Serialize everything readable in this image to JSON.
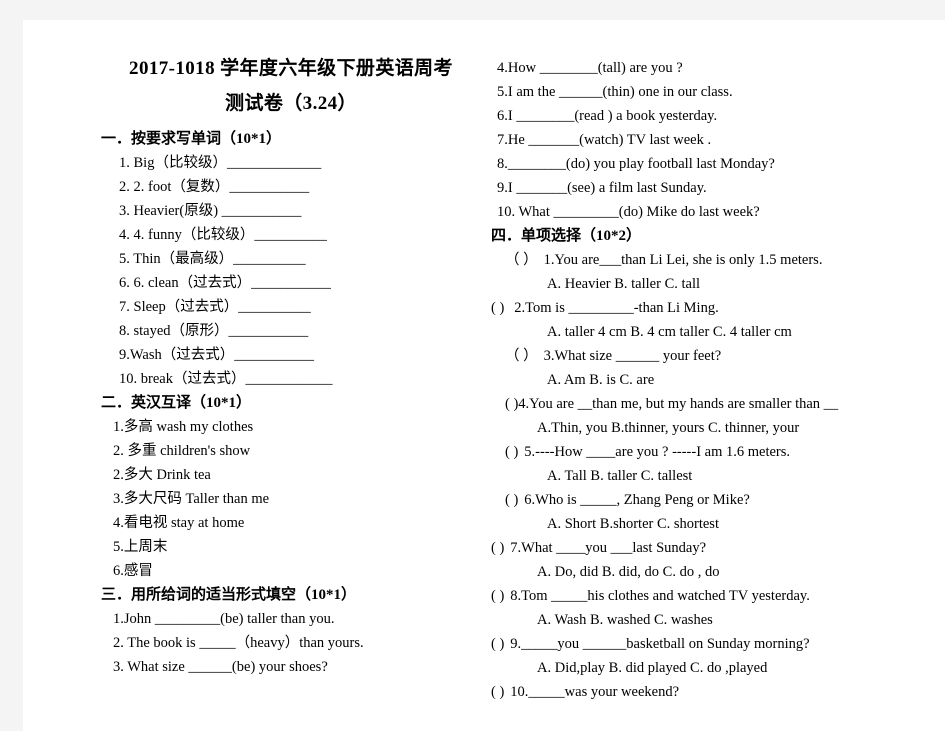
{
  "page": {
    "background_color": "#ffffff",
    "margin_color": "#f4f4f4",
    "text_color": "#000000"
  },
  "title": {
    "line1": "2017-1018 学年度六年级下册英语周考",
    "line2": "测试卷（3.24）"
  },
  "sections": [
    {
      "id": "section-one",
      "heading": "一．按要求写单词（10*1）",
      "items": [
        "1. Big（比较级）_____________",
        "2. 2. foot（复数）___________",
        "3. Heavier(原级) ___________",
        "4. 4. funny（比较级）__________",
        "5. Thin（最高级）__________",
        "6. 6. clean（过去式）___________",
        "7. Sleep（过去式）__________",
        "8. stayed（原形）___________",
        "9.Wash（过去式）___________",
        "10. break（过去式）____________"
      ]
    },
    {
      "id": "section-two",
      "heading": "二．英汉互译（10*1）",
      "items": [
        "1.多高 wash my clothes",
        "2. 多重 children's show",
        "2.多大 Drink tea",
        "3.多大尺码 Taller than me",
        "4.看电视 stay at home",
        "5.上周末",
        "6.感冒"
      ]
    },
    {
      "id": "section-three",
      "heading": "三．用所给词的适当形式填空（10*1）",
      "items": [
        "1.John _________(be) taller than you.",
        "2. The book   is _____（heavy）than yours.",
        "3. What size ______(be) your shoes?",
        "4.How ________(tall) are you ?",
        "5.I am the ______(thin) one in our class.",
        "6.I ________(read ) a book yesterday.",
        "7.He _______(watch) TV last week .",
        "8.________(do) you play football last Monday?",
        "9.I _______(see) a film last Sunday.",
        "10.    What _________(do) Mike do last week?"
      ]
    },
    {
      "id": "section-four",
      "heading": "四．单项选择（10*2）",
      "questions": [
        {
          "bracket": "（ ）",
          "stem": "1.You are___than Li Lei, she is only 1.5 meters.",
          "options": "A. Heavier            B. taller                    C. tall"
        },
        {
          "bracket": "(     )",
          "stem": "2.Tom is _________-than Li Ming.",
          "options": "A.    taller 4 cm      B. 4 cm taller      C. 4 taller cm"
        },
        {
          "bracket": "（ ）",
          "stem": "3.What size ______ your feet?",
          "options": "A. Am                  B. is                  C. are"
        },
        {
          "bracket": "(      )",
          "stem": "4.You are __than me, but my hands are smaller than __",
          "options": "A.Thin, you         B.thinner, yours     C. thinner, your"
        },
        {
          "bracket": "(     )",
          "stem": "5.----How ____are you ?    -----I am 1.6 meters.",
          "options": "A. Tall               B. taller               C. tallest"
        },
        {
          "bracket": "(     )",
          "stem": "6.Who is _____, Zhang Peng or Mike?",
          "options": "A. Short             B.shorter         C.    shortest"
        },
        {
          "bracket": "(     )",
          "stem": "7.What ____you ___last Sunday?",
          "options": "A. Do, did      B. did, do              C.   do ,   do"
        },
        {
          "bracket": "(     )",
          "stem": "8.Tom _____his clothes and watched TV yesterday.",
          "options": "A. Wash              B. washed         C. washes"
        },
        {
          "bracket": "(     )",
          "stem": "9._____you ______basketball on Sunday morning?",
          "options": "A. Did,play        B. did played      C.   do ,played"
        },
        {
          "bracket": "(     )",
          "stem": "10._____was your weekend?",
          "options": ""
        }
      ]
    }
  ]
}
